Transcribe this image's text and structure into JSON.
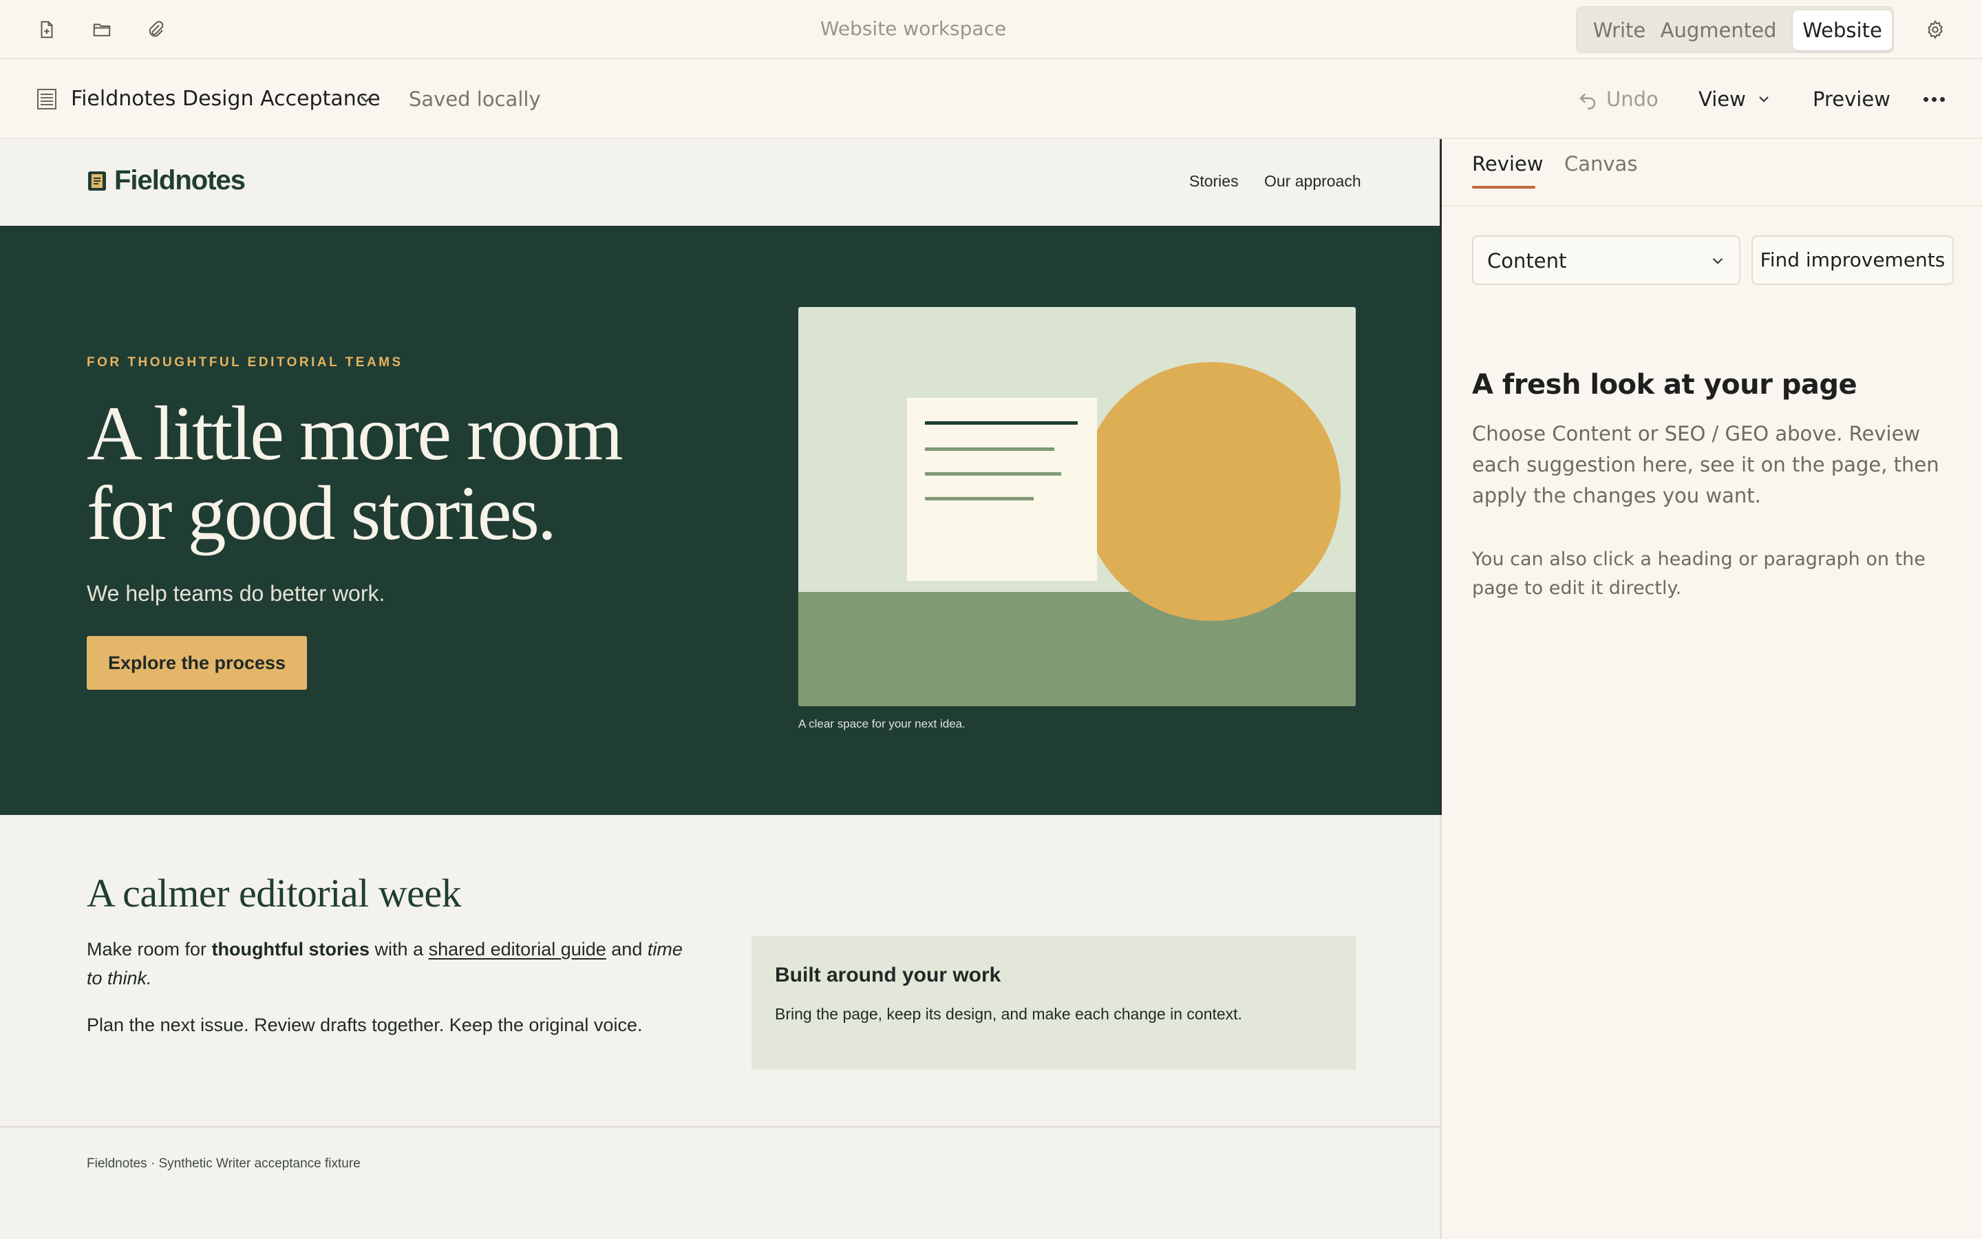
{
  "topbar": {
    "workspace_title": "Website workspace",
    "icons": [
      "new-file-icon",
      "open-folder-icon",
      "attachment-icon",
      "gear-icon"
    ],
    "modes": [
      {
        "label": "Write",
        "active": false
      },
      {
        "label": "Augmented",
        "active": false
      },
      {
        "label": "Website",
        "active": true
      }
    ]
  },
  "docbar": {
    "doc_name": "Fieldnotes Design Acceptance",
    "status": "Saved locally",
    "undo_label": "Undo",
    "view_label": "View",
    "preview_label": "Preview"
  },
  "site": {
    "brand": "Fieldnotes",
    "nav": [
      "Stories",
      "Our approach"
    ],
    "hero": {
      "eyebrow": "FOR THOUGHTFUL EDITORIAL TEAMS",
      "title_line1": "A little more room",
      "title_line2": "for good stories.",
      "subtitle": "We help teams do better work.",
      "cta": "Explore the process",
      "caption": "A clear space for your next idea."
    },
    "section": {
      "title": "A calmer editorial week",
      "p1_part1": "Make room for ",
      "p1_bold": "thoughtful stories",
      "p1_part2": " with a ",
      "p1_link": "shared editorial guide",
      "p1_part3": " and ",
      "p1_italic": "time to think.",
      "p2": "Plan the next issue. Review drafts together. Keep the original voice.",
      "callout_title": "Built around your work",
      "callout_body": "Bring the page, keep its design, and make each change in context."
    },
    "footer": "Fieldnotes · Synthetic Writer acceptance fixture"
  },
  "panel": {
    "tabs": [
      {
        "label": "Review",
        "active": true
      },
      {
        "label": "Canvas",
        "active": false
      }
    ],
    "select_value": "Content",
    "find_button": "Find improvements",
    "heading": "A fresh look at your page",
    "body1": "Choose Content or SEO / GEO above. Review each suggestion here, see it on the page, then apply the changes you want.",
    "body2": "You can also click a heading or paragraph on the page to edit it directly."
  },
  "colors": {
    "hero_bg": "#203d34",
    "accent_gold": "#e4b66a",
    "tab_underline": "#c06a3a",
    "callout_bg": "#e2e7d9"
  }
}
